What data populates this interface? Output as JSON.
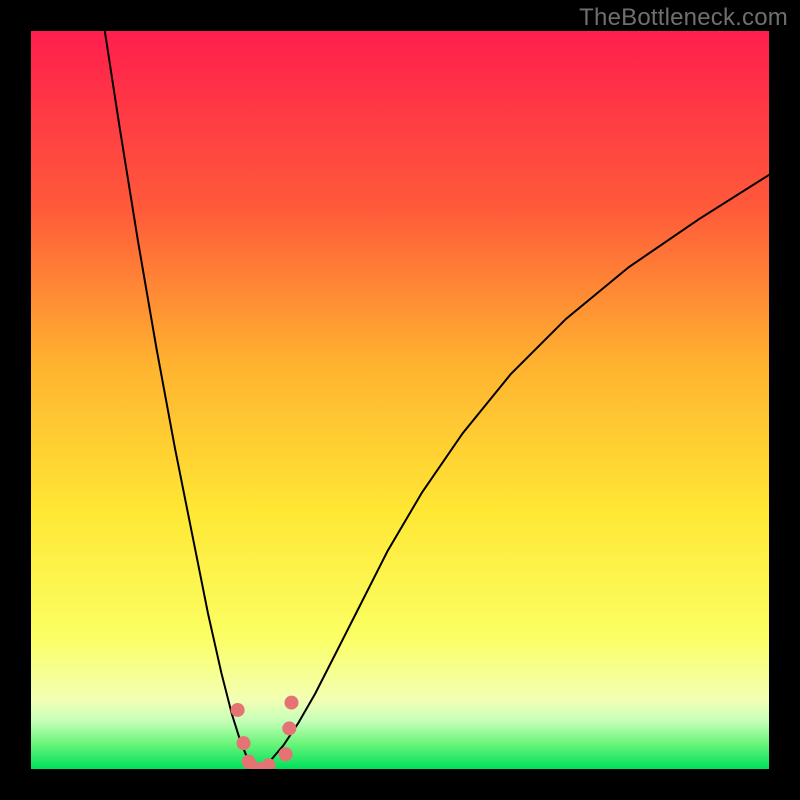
{
  "watermark": "TheBottleneck.com",
  "chart_data": {
    "type": "line",
    "title": "",
    "xlabel": "",
    "ylabel": "",
    "xlim": [
      0,
      100
    ],
    "ylim": [
      0,
      100
    ],
    "grid": false,
    "legend": false,
    "gradient_stops": [
      {
        "offset": 0.0,
        "color": "#ff1e4d"
      },
      {
        "offset": 0.24,
        "color": "#ff5a3a"
      },
      {
        "offset": 0.45,
        "color": "#ffb230"
      },
      {
        "offset": 0.65,
        "color": "#ffe734"
      },
      {
        "offset": 0.82,
        "color": "#fbff63"
      },
      {
        "offset": 0.905,
        "color": "#f3ffb3"
      },
      {
        "offset": 0.935,
        "color": "#c6ffb9"
      },
      {
        "offset": 0.965,
        "color": "#6cf57b"
      },
      {
        "offset": 1.0,
        "color": "#00e05b"
      }
    ],
    "curve_color": "#000000",
    "curve_width": 2,
    "series": [
      {
        "name": "bottleneck-curve",
        "branch": "left",
        "x": [
          10.0,
          12.0,
          14.5,
          17.0,
          19.5,
          22.0,
          24.0,
          25.8,
          27.2,
          28.3,
          29.3,
          30.3
        ],
        "y": [
          100.0,
          87.0,
          71.5,
          57.0,
          43.5,
          31.0,
          21.0,
          13.0,
          7.5,
          4.0,
          1.5,
          0.0
        ]
      },
      {
        "name": "bottleneck-curve",
        "branch": "right",
        "x": [
          30.3,
          31.0,
          32.5,
          34.2,
          36.2,
          38.5,
          41.2,
          44.5,
          48.3,
          53.0,
          58.5,
          65.0,
          72.5,
          81.0,
          90.5,
          100.0
        ],
        "y": [
          0.0,
          0.2,
          1.2,
          3.2,
          6.2,
          10.2,
          15.5,
          22.0,
          29.5,
          37.5,
          45.5,
          53.5,
          61.0,
          68.0,
          74.5,
          80.5
        ]
      }
    ],
    "markers": {
      "color": "#e57373",
      "radius": 7,
      "points": [
        {
          "x": 28.0,
          "y": 8.0
        },
        {
          "x": 28.8,
          "y": 3.5
        },
        {
          "x": 29.5,
          "y": 1.0
        },
        {
          "x": 30.3,
          "y": 0.0
        },
        {
          "x": 31.0,
          "y": 0.0
        },
        {
          "x": 32.2,
          "y": 0.5
        },
        {
          "x": 34.5,
          "y": 2.0
        },
        {
          "x": 35.0,
          "y": 5.5
        },
        {
          "x": 35.3,
          "y": 9.0
        }
      ]
    }
  }
}
